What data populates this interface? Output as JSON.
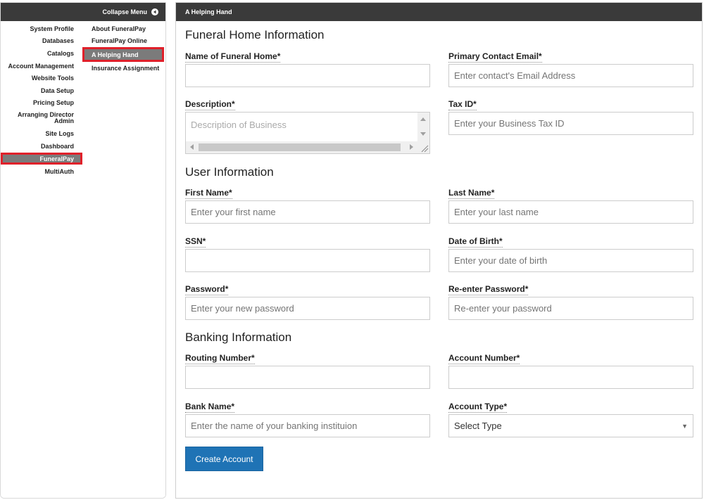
{
  "sidebar": {
    "collapse_label": "Collapse Menu",
    "left_items": [
      {
        "label": "System Profile"
      },
      {
        "label": "Databases"
      },
      {
        "label": "Catalogs"
      },
      {
        "label": "Account Management"
      },
      {
        "label": "Website Tools"
      },
      {
        "label": "Data Setup"
      },
      {
        "label": "Pricing Setup"
      },
      {
        "label": "Arranging Director Admin"
      },
      {
        "label": "Site Logs"
      },
      {
        "label": "Dashboard"
      },
      {
        "label": "FuneralPay",
        "active": true
      },
      {
        "label": "MultiAuth"
      }
    ],
    "right_items": [
      {
        "label": "About FuneralPay"
      },
      {
        "label": "FuneralPay Online"
      },
      {
        "label": "A Helping Hand",
        "active": true
      },
      {
        "label": "Insurance Assignment"
      }
    ]
  },
  "panel": {
    "header": "A Helping Hand",
    "sections": {
      "funeral_home": "Funeral Home Information",
      "user": "User Information",
      "banking": "Banking Information"
    },
    "fields": {
      "funeral_home_name": {
        "label": "Name of Funeral Home*",
        "value": "",
        "placeholder": ""
      },
      "primary_email": {
        "label": "Primary Contact Email*",
        "value": "",
        "placeholder": "Enter contact's Email Address"
      },
      "description": {
        "label": "Description*",
        "value": "",
        "placeholder": "Description of Business"
      },
      "tax_id": {
        "label": "Tax ID*",
        "value": "",
        "placeholder": "Enter your Business Tax ID"
      },
      "first_name": {
        "label": "First Name*",
        "value": "",
        "placeholder": "Enter your first name"
      },
      "last_name": {
        "label": "Last Name*",
        "value": "",
        "placeholder": "Enter your last name"
      },
      "ssn": {
        "label": "SSN*",
        "value": "",
        "placeholder": ""
      },
      "dob": {
        "label": "Date of Birth*",
        "value": "",
        "placeholder": "Enter your date of birth"
      },
      "password": {
        "label": "Password*",
        "value": "",
        "placeholder": "Enter your new password"
      },
      "reenter_password": {
        "label": "Re-enter Password*",
        "value": "",
        "placeholder": "Re-enter your password"
      },
      "routing_number": {
        "label": "Routing Number*",
        "value": "",
        "placeholder": ""
      },
      "account_number": {
        "label": "Account Number*",
        "value": "",
        "placeholder": ""
      },
      "bank_name": {
        "label": "Bank Name*",
        "value": "",
        "placeholder": "Enter the name of your banking instituion"
      },
      "account_type": {
        "label": "Account Type*",
        "selected": "Select Type"
      }
    },
    "submit_label": "Create Account"
  },
  "colors": {
    "header_bg": "#3a3a3a",
    "active_item_bg": "#7b7b7b",
    "highlight_outline": "#e0202a",
    "button_bg": "#1f73b5"
  }
}
